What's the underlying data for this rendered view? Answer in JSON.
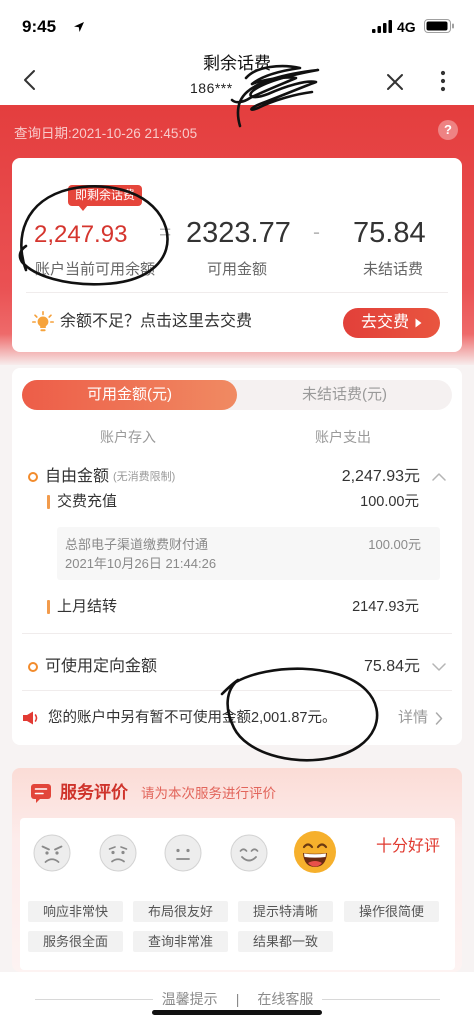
{
  "status_bar": {
    "time": "9:45",
    "network": "4G",
    "icons": [
      "location-arrow-icon",
      "signal-icon",
      "battery-icon"
    ]
  },
  "nav": {
    "title": "剩余话费",
    "subtitle": "186***",
    "icons": [
      "back-chevron-icon",
      "close-icon",
      "more-vertical-icon"
    ]
  },
  "header": {
    "query_date": "查询日期:2021-10-26 21:45:05",
    "help": "?"
  },
  "summary": {
    "badge": "即剩余话费",
    "balance": "2,247.93",
    "equals": "=",
    "available": "2323.77",
    "minus": "-",
    "unsettled": "75.84",
    "balance_label": "账户当前可用余额",
    "available_label": "可用金额",
    "unsettled_label": "未结话费",
    "tip": "余额不足？点击这里去交费",
    "tip_icon": "lightbulb-icon",
    "pay_button": "去交费"
  },
  "detail": {
    "tabs": [
      {
        "label": "可用金额(元)",
        "active": true
      },
      {
        "label": "未结话费(元)",
        "active": false
      }
    ],
    "col_in": "账户存入",
    "col_out": "账户支出",
    "free": {
      "label": "自由金额",
      "note": "(无消费限制)",
      "amount": "2,247.93元",
      "expanded": true
    },
    "items": [
      {
        "label": "交费充值",
        "amount": "100.00元",
        "records": [
          {
            "channel": "总部电子渠道缴费财付通",
            "amount": "100.00元",
            "time": "2021年10月26日 21:44:26"
          }
        ]
      },
      {
        "label": "上月结转",
        "amount": "2147.93元"
      }
    ],
    "directed": {
      "label": "可使用定向金额",
      "amount": "75.84元",
      "expanded": false
    },
    "notice": {
      "text": "您的账户中另有暂不可使用金额2,001.87元。",
      "link": "详情",
      "icon": "speaker-icon"
    }
  },
  "rating": {
    "title": "服务评价",
    "subtitle": "请为本次服务进行评价",
    "faces": [
      "angry-face-icon",
      "sad-face-icon",
      "neutral-face-icon",
      "smile-face-icon",
      "grinning-face-icon"
    ],
    "selected_index": 4,
    "selected_label": "十分好评",
    "tags": [
      "响应非常快",
      "布局很友好",
      "提示特清晰",
      "操作很简便",
      "服务很全面",
      "查询非常准",
      "结果都一致"
    ]
  },
  "footer": {
    "tips": "温馨提示",
    "separator": "|",
    "service": "在线客服"
  },
  "colors": {
    "header_red": "#e43e3e",
    "balance_red": "#d5352e",
    "button_red": "#e2403a",
    "tab_active": "#ed5d48",
    "bullet_orange": "#f28b2c",
    "rating_yellow": "#f6b02c",
    "annotation_ink": "#111111"
  }
}
